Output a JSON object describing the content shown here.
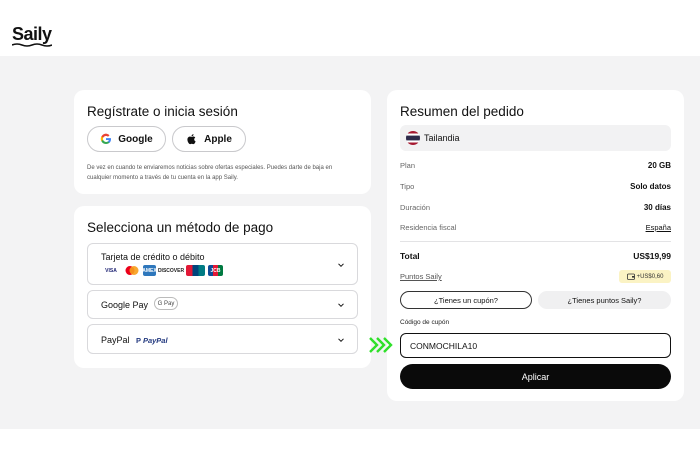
{
  "brand": {
    "name": "Saily"
  },
  "login": {
    "title": "Regístrate o inicia sesión",
    "google_label": "Google",
    "apple_label": "Apple",
    "note": "De vez en cuando te enviaremos noticias sobre ofertas especiales. Puedes darte de baja en cualquier momento a través de tu cuenta en la app Saily."
  },
  "payment": {
    "title": "Selecciona un método de pago",
    "methods": [
      {
        "label": "Tarjeta de crédito o débito",
        "logos": [
          "VISA",
          "Mastercard",
          "AMEX",
          "DISCOVER",
          "UnionPay",
          "JCB"
        ]
      },
      {
        "label": "Google Pay",
        "badge": "G Pay"
      },
      {
        "label": "PayPal",
        "logo": "PayPal"
      }
    ]
  },
  "summary": {
    "title": "Resumen del pedido",
    "country": "Tailandia",
    "rows": [
      {
        "label": "Plan",
        "value": "20 GB"
      },
      {
        "label": "Tipo",
        "value": "Solo datos"
      },
      {
        "label": "Duración",
        "value": "30 días"
      },
      {
        "label": "Residencia fiscal",
        "value": "España"
      }
    ],
    "total_label": "Total",
    "total_value": "US$19,99",
    "points_label": "Puntos Saily",
    "points_value": "+US$0,60",
    "coupon_tab": "¿Tienes un cupón?",
    "points_tab": "¿Tienes puntos Saily?",
    "coupon_field_label": "Código de cupón",
    "coupon_value": "CONMOCHILA10",
    "apply_label": "Aplicar"
  },
  "colors": {
    "accent": "#0a0a0a",
    "annotation_arrows": "#2fe02a",
    "background": "#f3f3f4",
    "bonus_badge": "#fbf3c4"
  }
}
